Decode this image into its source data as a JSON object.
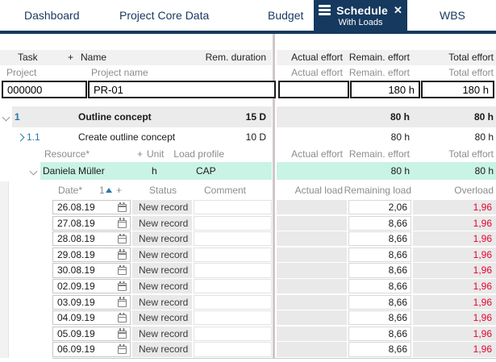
{
  "colors": {
    "navy": "#16395F",
    "accent_blue": "#2779A7",
    "highlight_mint": "#C9F3E5",
    "overload_red": "#E4032E",
    "cell_gray": "#E9E9E9"
  },
  "icons": {
    "close": "✕"
  },
  "tabs": [
    {
      "label": "Dashboard"
    },
    {
      "label": "Project Core Data"
    },
    {
      "label": "Budget"
    },
    {
      "label": "Schedule",
      "sublabel": "With Loads",
      "active": true
    },
    {
      "label": "WBS"
    }
  ],
  "task_section": {
    "header": {
      "task": "Task",
      "plus": "+",
      "name": "Name",
      "rem_duration": "Rem. duration",
      "actual_effort": "Actual effort",
      "remain_effort": "Remain. effort",
      "total_effort": "Total effort"
    },
    "subheader": {
      "project": "Project",
      "project_name": "Project name",
      "actual_effort": "Actual effort",
      "remain_effort": "Remain. effort",
      "total_effort": "Total effort"
    },
    "project_row": {
      "id": "000000",
      "name": "PR-01",
      "actual_effort": "",
      "remain_effort": "180 h",
      "total_effort": "180 h"
    },
    "tasks": [
      {
        "num": "1",
        "name": "Outline concept",
        "rem_duration": "15 D",
        "remain_effort": "80 h",
        "total_effort": "80 h"
      },
      {
        "num": "1.1",
        "name": "Create outline concept",
        "rem_duration": "10 D",
        "remain_effort": "80 h",
        "total_effort": "80 h"
      }
    ]
  },
  "resource_section": {
    "header": {
      "resource": "Resource*",
      "plus": "+",
      "unit": "Unit",
      "load_profile": "Load profile",
      "actual_effort": "Actual effort",
      "remain_effort": "Remain. effort",
      "total_effort": "Total effort"
    },
    "resource_row": {
      "name": "Daniela Müller",
      "unit": "h",
      "load_profile": "CAP",
      "remain_effort": "80 h",
      "total_effort": "80 h"
    }
  },
  "date_table": {
    "header": {
      "date": "Date*",
      "sort_num": "1",
      "sort_plus": "+",
      "status": "Status",
      "comment": "Comment",
      "actual_load": "Actual load",
      "remaining_load": "Remaining load",
      "overload": "Overload"
    },
    "rows": [
      {
        "date": "26.08.19",
        "status": "New record",
        "comment": "",
        "actual_load": "",
        "remaining_load": "2,06",
        "overload": "1,96"
      },
      {
        "date": "27.08.19",
        "status": "New record",
        "comment": "",
        "actual_load": "",
        "remaining_load": "8,66",
        "overload": "1,96"
      },
      {
        "date": "28.08.19",
        "status": "New record",
        "comment": "",
        "actual_load": "",
        "remaining_load": "8,66",
        "overload": "1,96"
      },
      {
        "date": "29.08.19",
        "status": "New record",
        "comment": "",
        "actual_load": "",
        "remaining_load": "8,66",
        "overload": "1,96"
      },
      {
        "date": "30.08.19",
        "status": "New record",
        "comment": "",
        "actual_load": "",
        "remaining_load": "8,66",
        "overload": "1,96"
      },
      {
        "date": "02.09.19",
        "status": "New record",
        "comment": "",
        "actual_load": "",
        "remaining_load": "8,66",
        "overload": "1,96"
      },
      {
        "date": "03.09.19",
        "status": "New record",
        "comment": "",
        "actual_load": "",
        "remaining_load": "8,66",
        "overload": "1,96"
      },
      {
        "date": "04.09.19",
        "status": "New record",
        "comment": "",
        "actual_load": "",
        "remaining_load": "8,66",
        "overload": "1,96"
      },
      {
        "date": "05.09.19",
        "status": "New record",
        "comment": "",
        "actual_load": "",
        "remaining_load": "8,66",
        "overload": "1,96"
      },
      {
        "date": "06.09.19",
        "status": "New record",
        "comment": "",
        "actual_load": "",
        "remaining_load": "8,66",
        "overload": "1,96"
      }
    ]
  }
}
